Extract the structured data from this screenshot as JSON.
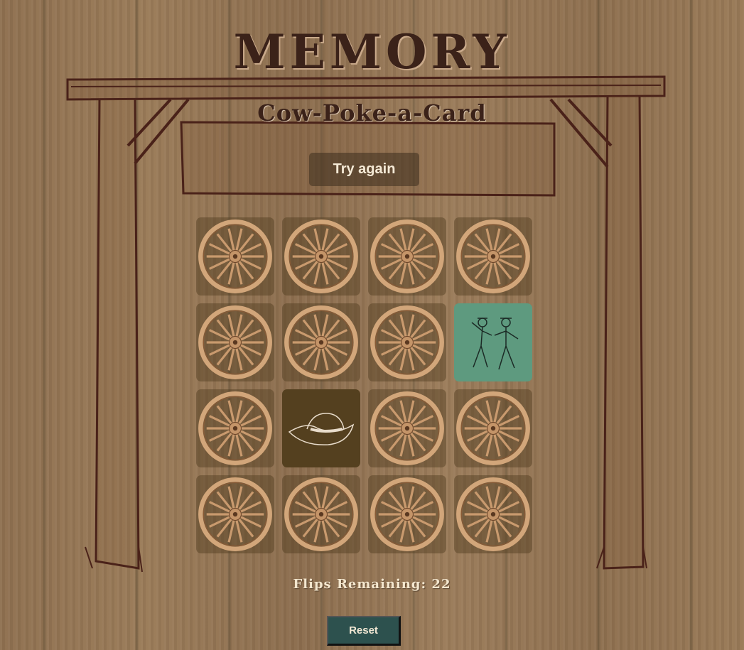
{
  "header": {
    "title": "MEMORY",
    "subtitle": "Cow-Poke-a-Card"
  },
  "status": {
    "message_button": "Try again"
  },
  "board": {
    "rows": 4,
    "cols": 4,
    "cards": [
      {
        "state": "back",
        "icon": "wagon-wheel-icon"
      },
      {
        "state": "back",
        "icon": "wagon-wheel-icon"
      },
      {
        "state": "back",
        "icon": "wagon-wheel-icon"
      },
      {
        "state": "back",
        "icon": "wagon-wheel-icon"
      },
      {
        "state": "back",
        "icon": "wagon-wheel-icon"
      },
      {
        "state": "back",
        "icon": "wagon-wheel-icon"
      },
      {
        "state": "back",
        "icon": "wagon-wheel-icon"
      },
      {
        "state": "face",
        "icon": "dancing-cowboys-icon"
      },
      {
        "state": "back",
        "icon": "wagon-wheel-icon"
      },
      {
        "state": "face",
        "icon": "cowboy-hat-icon"
      },
      {
        "state": "back",
        "icon": "wagon-wheel-icon"
      },
      {
        "state": "back",
        "icon": "wagon-wheel-icon"
      },
      {
        "state": "back",
        "icon": "wagon-wheel-icon"
      },
      {
        "state": "back",
        "icon": "wagon-wheel-icon"
      },
      {
        "state": "back",
        "icon": "wagon-wheel-icon"
      },
      {
        "state": "back",
        "icon": "wagon-wheel-icon"
      }
    ]
  },
  "footer": {
    "flips_label": "Flips Remaining: 22",
    "reset_label": "Reset"
  },
  "colors": {
    "title": "#3b2219",
    "dancers_card": "#5e9a7f",
    "hat_card": "#54401f",
    "reset_button": "#2d514e"
  }
}
